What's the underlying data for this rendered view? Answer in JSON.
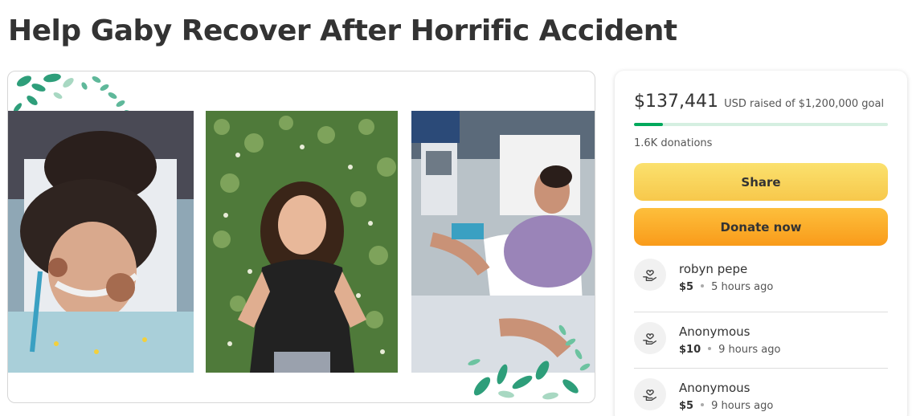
{
  "page": {
    "title": "Help Gaby Recover After Horrific Accident"
  },
  "media": {
    "photos": [
      {
        "name": "photo-hospital-bed"
      },
      {
        "name": "photo-standing-portrait"
      },
      {
        "name": "photo-hospital-room"
      }
    ]
  },
  "fundraiser": {
    "amount": "$137,441",
    "raised_text": "USD raised of $1,200,000 goal",
    "progress_fraction": 0.115,
    "donations_count": "1.6K donations",
    "share_label": "Share",
    "donate_label": "Donate now"
  },
  "donors": [
    {
      "name": "robyn pepe",
      "amount": "$5",
      "time": "5 hours ago"
    },
    {
      "name": "Anonymous",
      "amount": "$10",
      "time": "9 hours ago"
    },
    {
      "name": "Anonymous",
      "amount": "$5",
      "time": "9 hours ago"
    }
  ],
  "colors": {
    "progress": "#02a95c",
    "share_button": "#f7c84b",
    "donate_button": "#f99b1a"
  },
  "icons": {
    "donor_avatar": "heart-hand-icon"
  }
}
